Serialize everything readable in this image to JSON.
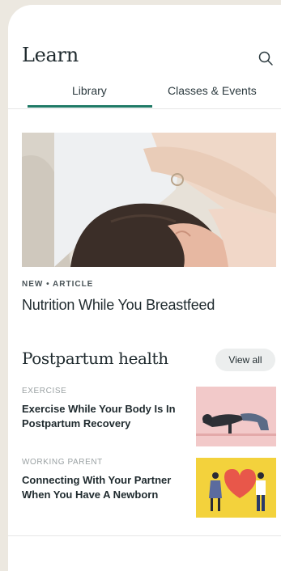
{
  "header": {
    "title": "Learn",
    "search_icon": "search-icon"
  },
  "tabs": [
    {
      "label": "Library",
      "active": true
    },
    {
      "label": "Classes & Events",
      "active": false
    }
  ],
  "featured": {
    "eyebrow": "NEW • ARTICLE",
    "title": "Nutrition While You Breastfeed"
  },
  "section": {
    "title": "Postpartum health",
    "view_all_label": "View all",
    "items": [
      {
        "category": "EXERCISE",
        "title": "Exercise While Your Body Is In Postpartum Recovery"
      },
      {
        "category": "WORKING PARENT",
        "title": "Connecting With Your Partner When You Have A Newborn"
      }
    ]
  },
  "colors": {
    "accent": "#1f7a66",
    "text": "#1f2a2e",
    "thumb_pink": "#f2c9c9",
    "thumb_yellow": "#f3d23c"
  }
}
